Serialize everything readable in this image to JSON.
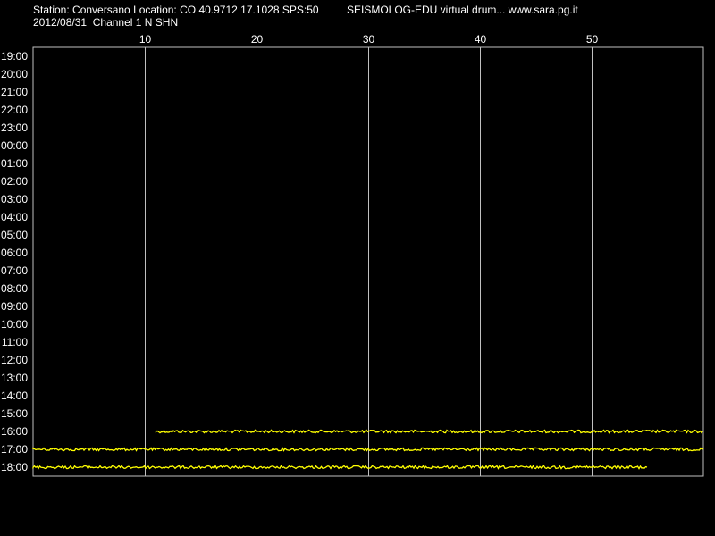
{
  "header": {
    "station_line": "Station: Conversano Location: CO 40.9712 17.1028 SPS:50",
    "brand_line": "SEISMOLOG-EDU virtual drum... www.sara.pg.it",
    "date_line": "2012/08/31  Channel 1 N SHN"
  },
  "colors": {
    "background": "#000000",
    "trace": "#ffff00",
    "grid": "#c0c0c0",
    "text": "#ffffff"
  },
  "chart_data": {
    "type": "line",
    "title": "",
    "xlabel": "",
    "ylabel": "",
    "xlim": [
      0,
      60
    ],
    "x_ticks": [
      10,
      20,
      30,
      40,
      50
    ],
    "y_ticks": [
      "19:00",
      "20:00",
      "21:00",
      "22:00",
      "23:00",
      "00:00",
      "01:00",
      "02:00",
      "03:00",
      "04:00",
      "05:00",
      "06:00",
      "07:00",
      "08:00",
      "09:00",
      "10:00",
      "11:00",
      "12:00",
      "13:00",
      "14:00",
      "15:00",
      "16:00",
      "17:00",
      "18:00"
    ],
    "grid_vertical": true,
    "grid_horizontal": false,
    "series": [
      {
        "row": "16:00",
        "x_start": 11,
        "x_end": 60
      },
      {
        "row": "17:00",
        "x_start": 0,
        "x_end": 60
      },
      {
        "row": "18:00",
        "x_start": 0,
        "x_end": 55
      }
    ]
  }
}
